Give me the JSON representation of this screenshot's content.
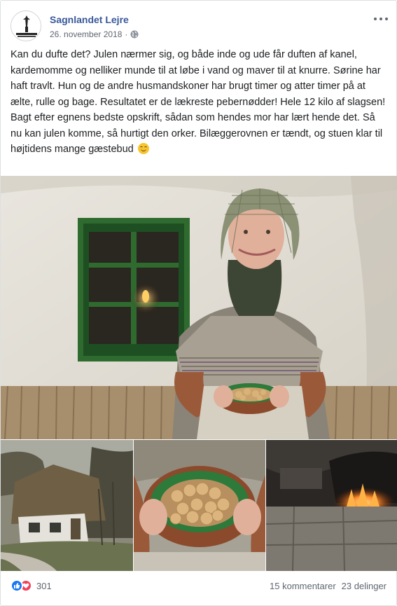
{
  "post": {
    "page_name": "Sagnlandet Lejre",
    "date": "26. november 2018",
    "privacy_icon": "globe-icon",
    "more_icon": "more-options-icon",
    "logo_text": "SAGNLANDET LEJRE",
    "text": "Kan du dufte det? Julen nærmer sig, og både inde og ude får duften af kanel, kardemomme og nelliker munde til at løbe i vand og maver til at knurre. Sørine har haft travlt. Hun og de andre husmandskoner har brugt timer og atter timer på at ælte, rulle og bage. Resultatet er de lækreste pebernødder! Hele 12 kilo af slagsen! Bagt efter egnens bedste opskrift, sådan som hendes mor har lært hende det. Så nu kan julen komme, så hurtigt den orker. Bilæggerovnen er tændt, og stuen klar til højtidens mange gæstebud",
    "emoji": "smiling-face-emoji"
  },
  "photos": {
    "main": "woman-holding-bowl-of-pebernodder-photo",
    "thumbs": [
      "thatched-cottage-photo",
      "bowl-of-pebernodder-closeup-photo",
      "fire-in-oven-photo"
    ]
  },
  "footer": {
    "reaction_icons": [
      "like-icon",
      "love-icon"
    ],
    "reaction_count": "301",
    "comments": "15 kommentarer",
    "shares": "23 delinger"
  },
  "colors": {
    "link_blue": "#385898",
    "like_blue": "#1877f2",
    "love_red": "#f33e58",
    "meta_gray": "#616770"
  }
}
